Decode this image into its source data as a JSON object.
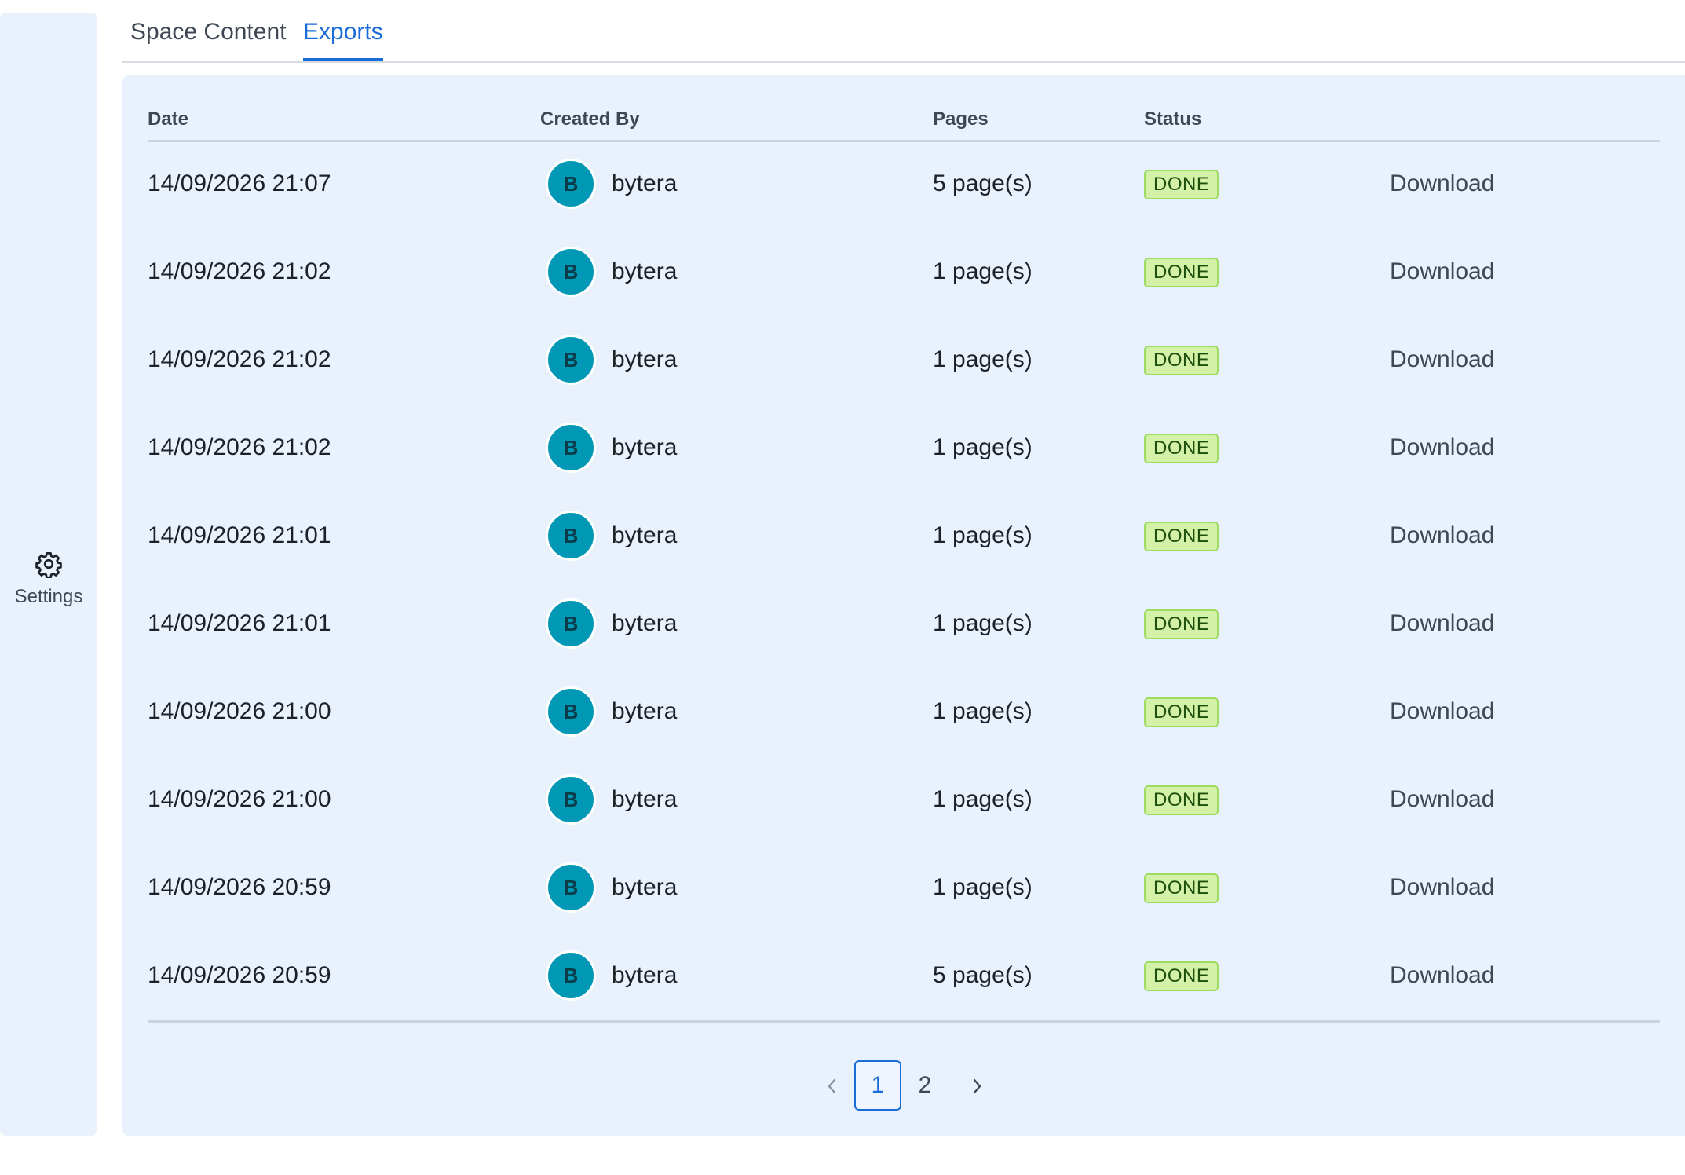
{
  "sidebar": {
    "settings_label": "Settings"
  },
  "tabs": [
    {
      "label": "Space Content",
      "active": false
    },
    {
      "label": "Exports",
      "active": true
    }
  ],
  "table": {
    "headers": {
      "date": "Date",
      "created_by": "Created By",
      "pages": "Pages",
      "status": "Status"
    },
    "rows": [
      {
        "date": "14/09/2026 21:07",
        "avatar": "B",
        "user": "bytera",
        "pages": "5 page(s)",
        "status": "DONE",
        "action": "Download"
      },
      {
        "date": "14/09/2026 21:02",
        "avatar": "B",
        "user": "bytera",
        "pages": "1 page(s)",
        "status": "DONE",
        "action": "Download"
      },
      {
        "date": "14/09/2026 21:02",
        "avatar": "B",
        "user": "bytera",
        "pages": "1 page(s)",
        "status": "DONE",
        "action": "Download"
      },
      {
        "date": "14/09/2026 21:02",
        "avatar": "B",
        "user": "bytera",
        "pages": "1 page(s)",
        "status": "DONE",
        "action": "Download"
      },
      {
        "date": "14/09/2026 21:01",
        "avatar": "B",
        "user": "bytera",
        "pages": "1 page(s)",
        "status": "DONE",
        "action": "Download"
      },
      {
        "date": "14/09/2026 21:01",
        "avatar": "B",
        "user": "bytera",
        "pages": "1 page(s)",
        "status": "DONE",
        "action": "Download"
      },
      {
        "date": "14/09/2026 21:00",
        "avatar": "B",
        "user": "bytera",
        "pages": "1 page(s)",
        "status": "DONE",
        "action": "Download"
      },
      {
        "date": "14/09/2026 21:00",
        "avatar": "B",
        "user": "bytera",
        "pages": "1 page(s)",
        "status": "DONE",
        "action": "Download"
      },
      {
        "date": "14/09/2026 20:59",
        "avatar": "B",
        "user": "bytera",
        "pages": "1 page(s)",
        "status": "DONE",
        "action": "Download"
      },
      {
        "date": "14/09/2026 20:59",
        "avatar": "B",
        "user": "bytera",
        "pages": "5 page(s)",
        "status": "DONE",
        "action": "Download"
      }
    ]
  },
  "pagination": {
    "pages": [
      "1",
      "2"
    ],
    "current": "1"
  },
  "colors": {
    "accent": "#1a6dd8",
    "panel_bg": "#e9f1fd",
    "avatar_bg": "#0098b5",
    "status_done_bg": "#d4f2a7",
    "status_done_border": "#9ddb61"
  },
  "icons": {
    "settings": "gear-icon",
    "prev": "chevron-left-icon",
    "next": "chevron-right-icon"
  }
}
